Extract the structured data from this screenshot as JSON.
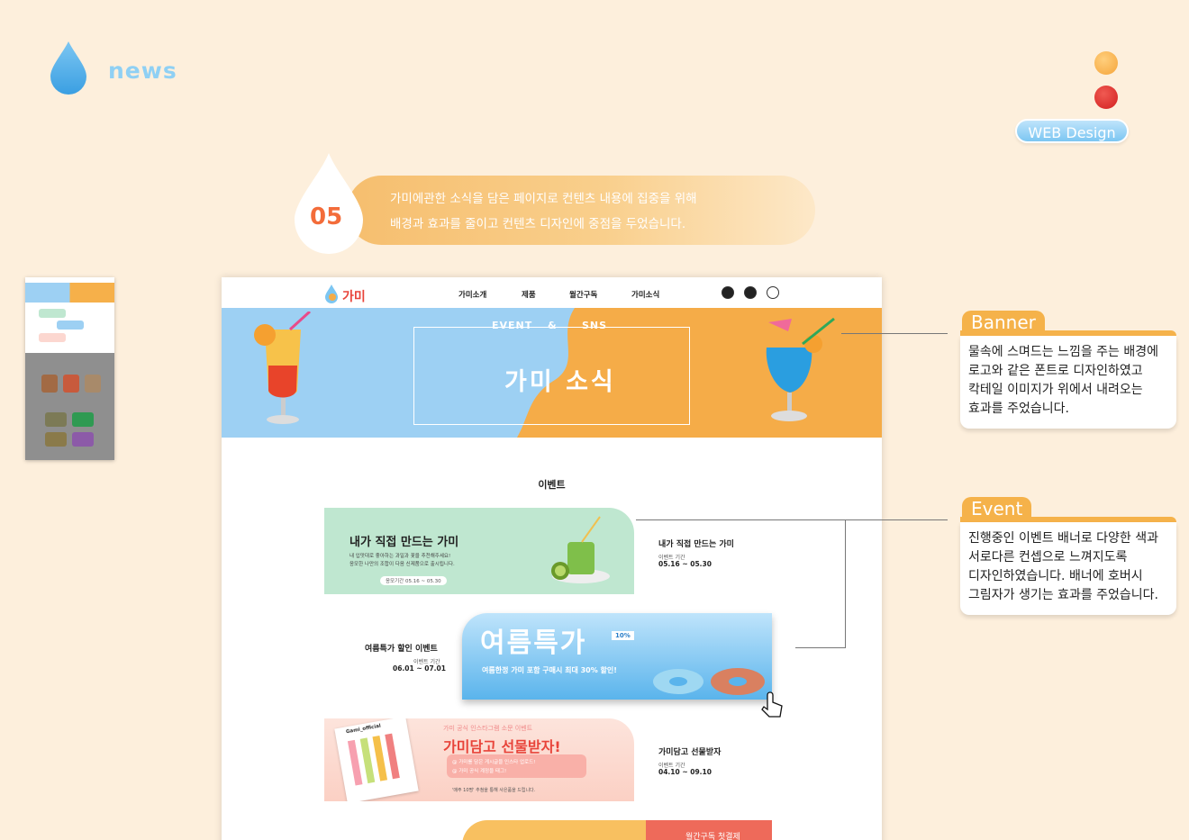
{
  "header": {
    "title": "news",
    "badge": "WEB Design"
  },
  "intro": {
    "number": "05",
    "line1": "가미에관한 소식을 담은 페이지로 컨텐츠 내용에 집중을 위해",
    "line2": "배경과 효과를 줄이고 컨텐츠 디자인에 중점을 두었습니다."
  },
  "mockup": {
    "logo_text": "가미",
    "nav": [
      "가미소개",
      "제품",
      "월간구독",
      "가미소식"
    ],
    "hero": {
      "sub_left": "EVENT",
      "sub_mid": "&",
      "sub_right": "SNS",
      "title": "가미 소식"
    },
    "section_title": "이벤트",
    "events": [
      {
        "banner_title": "내가 직접 만드는 가미",
        "banner_desc1": "내 입맛대로 좋아하는 과일과 꽃을 추천해주세요!",
        "banner_desc2": "응모한 나만의 조합이 다음 신제품으로 출시됩니다.",
        "banner_period": "응모기간 05.16 ~ 05.30",
        "title": "내가 직접 만드는 가미",
        "sub": "이벤트 기간",
        "date": "05.16 ~ 05.30"
      },
      {
        "banner_title": "여름특가",
        "banner_badge": "10%",
        "banner_desc": "여름한정 가미 포함 구매시 최대 30% 할인!",
        "title": "여름특가 할인 이벤트",
        "sub": "이벤트 기간",
        "date": "06.01 ~ 07.01"
      },
      {
        "banner_top": "가미 공식 인스타그램 소문 이벤트",
        "banner_title": "가미담고 선물받자!",
        "banner_handle": "Gami_official",
        "banner_line1": "@ 가미를 담은 게시글을 인스타 업로드!",
        "banner_line2": "@ 가미 공식 계정을 태그!",
        "banner_foot": "'매주 10명' 추첨을 통해 사은품을 드립니다.",
        "title": "가미담고 선물받자",
        "sub": "이벤트 기간",
        "date": "04.10 ~ 09.10"
      },
      {
        "banner_title": "월간구독 첫결제"
      }
    ]
  },
  "annotations": {
    "banner": {
      "label": "Banner",
      "lines": [
        "물속에 스며드는 느낌을 주는 배경에",
        "로고와 같은 폰트로 디자인하였고",
        "칵테일 이미지가 위에서 내려오는",
        "효과를 주었습니다."
      ]
    },
    "event": {
      "label": "Event",
      "lines": [
        "진행중인 이벤트 배너로 다양한 색과",
        "서로다른 컨셉으로 느껴지도록",
        "디자인하였습니다.  배너에 호버시",
        "그림자가 생기는 효과를 주었습니다."
      ]
    }
  },
  "colors": {
    "background": "#fdefdc",
    "accent_orange": "#f5ac48",
    "accent_blue": "#9dd0f3",
    "accent_red": "#d21f1f"
  }
}
